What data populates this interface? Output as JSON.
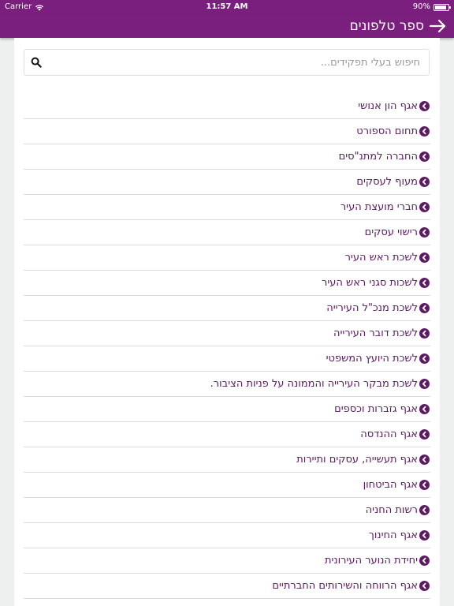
{
  "status_bar": {
    "carrier": "Carrier",
    "time": "11:57 AM",
    "battery_percent": "90%",
    "battery_level": 0.9
  },
  "nav": {
    "title": "ספר טלפונים",
    "back_icon": "arrow-right-icon",
    "color": "#7b1f7f"
  },
  "search": {
    "placeholder": "חיפוש בעלי תפקידים...",
    "value": "",
    "icon": "search-icon"
  },
  "list": {
    "item_color": "#5e1a63",
    "chevron_icon": "chevron-circle-left-icon",
    "items": [
      {
        "label": "אגף הון אנושי"
      },
      {
        "label": "תחום הספורט"
      },
      {
        "label": "החברה למתנ\"סים"
      },
      {
        "label": "מעוף לעסקים"
      },
      {
        "label": "חברי מועצת העיר"
      },
      {
        "label": "רישוי עסקים"
      },
      {
        "label": "לשכת ראש העיר"
      },
      {
        "label": "לשכות סגני ראש העיר"
      },
      {
        "label": "לשכת מנכ\"ל העירייה"
      },
      {
        "label": "לשכת דובר העירייה"
      },
      {
        "label": "לשכת היועץ המשפטי"
      },
      {
        "label": "לשכת מבקר העירייה והממונה על פניות הציבור."
      },
      {
        "label": "אגף גזברות וכספים"
      },
      {
        "label": "אגף ההנדסה"
      },
      {
        "label": "אגף תעשייה, עסקים ותיירות"
      },
      {
        "label": "אגף הביטחון"
      },
      {
        "label": "רשות החניה"
      },
      {
        "label": "אגף החינוך"
      },
      {
        "label": "יחידת הנוער העירונית"
      },
      {
        "label": "אגף הרווחה והשירותים החברתיים"
      }
    ]
  }
}
